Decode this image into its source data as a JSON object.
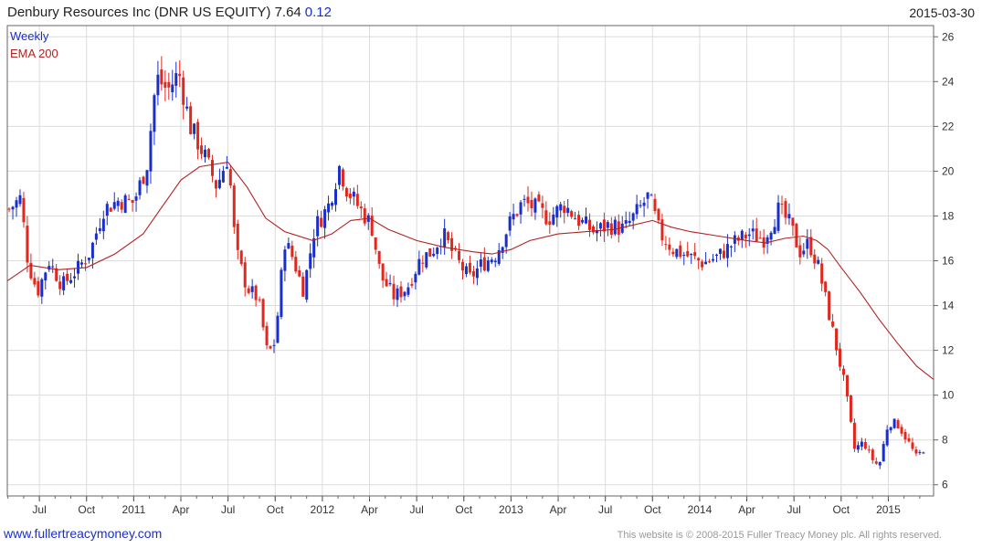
{
  "header": {
    "title": "Denbury Resources Inc (DNR US EQUITY) 7.64",
    "change": "0.12",
    "date": "2015-03-30"
  },
  "footer": {
    "site": "www.fullertreacymoney.com",
    "copyright": "This website is © 2008-2015 Fuller Treacy Money plc. All rights reserved."
  },
  "colors": {
    "up": "#1a2fc8",
    "down": "#e0281e",
    "ema": "#b22222",
    "grid": "#dcdcdc"
  },
  "chart_data": {
    "type": "candlestick",
    "legend": [
      {
        "label": "Weekly",
        "color": "#1a2fc8"
      },
      {
        "label": "EMA 200",
        "color": "#b22222"
      }
    ],
    "legend_position": "top-left",
    "grid": true,
    "y_axis_position": "right",
    "ylim": [
      5.5,
      26.5
    ],
    "yticks": [
      6,
      8,
      10,
      12,
      14,
      16,
      18,
      20,
      22,
      24,
      26
    ],
    "xlim": [
      2010.33,
      2015.24
    ],
    "xticks": [
      {
        "label": "Jul",
        "x": 2010.5
      },
      {
        "label": "Oct",
        "x": 2010.75
      },
      {
        "label": "2011",
        "x": 2011.0
      },
      {
        "label": "Apr",
        "x": 2011.25
      },
      {
        "label": "Jul",
        "x": 2011.5
      },
      {
        "label": "Oct",
        "x": 2011.75
      },
      {
        "label": "2012",
        "x": 2012.0
      },
      {
        "label": "Apr",
        "x": 2012.25
      },
      {
        "label": "Jul",
        "x": 2012.5
      },
      {
        "label": "Oct",
        "x": 2012.75
      },
      {
        "label": "2013",
        "x": 2013.0
      },
      {
        "label": "Apr",
        "x": 2013.25
      },
      {
        "label": "Jul",
        "x": 2013.5
      },
      {
        "label": "Oct",
        "x": 2013.75
      },
      {
        "label": "2014",
        "x": 2014.0
      },
      {
        "label": "Apr",
        "x": 2014.25
      },
      {
        "label": "Jul",
        "x": 2014.5
      },
      {
        "label": "Oct",
        "x": 2014.75
      },
      {
        "label": "2015",
        "x": 2015.0
      }
    ],
    "close_anchors": [
      [
        2010.34,
        18.3
      ],
      [
        2010.4,
        18.8
      ],
      [
        2010.44,
        15.9
      ],
      [
        2010.49,
        14.6
      ],
      [
        2010.55,
        16.0
      ],
      [
        2010.62,
        14.9
      ],
      [
        2010.7,
        15.6
      ],
      [
        2010.77,
        16.4
      ],
      [
        2010.84,
        18.3
      ],
      [
        2010.92,
        18.7
      ],
      [
        2011.0,
        18.6
      ],
      [
        2011.07,
        20.3
      ],
      [
        2011.12,
        24.2
      ],
      [
        2011.18,
        23.6
      ],
      [
        2011.24,
        24.4
      ],
      [
        2011.3,
        22.0
      ],
      [
        2011.38,
        20.6
      ],
      [
        2011.44,
        19.3
      ],
      [
        2011.5,
        20.7
      ],
      [
        2011.54,
        16.5
      ],
      [
        2011.6,
        14.8
      ],
      [
        2011.66,
        14.3
      ],
      [
        2011.71,
        11.8
      ],
      [
        2011.75,
        12.4
      ],
      [
        2011.8,
        16.9
      ],
      [
        2011.84,
        16.2
      ],
      [
        2011.9,
        14.7
      ],
      [
        2011.96,
        17.5
      ],
      [
        2012.03,
        18.4
      ],
      [
        2012.09,
        20.2
      ],
      [
        2012.13,
        19.2
      ],
      [
        2012.2,
        18.3
      ],
      [
        2012.26,
        17.6
      ],
      [
        2012.31,
        15.3
      ],
      [
        2012.38,
        14.4
      ],
      [
        2012.45,
        14.8
      ],
      [
        2012.52,
        16.1
      ],
      [
        2012.58,
        16.4
      ],
      [
        2012.64,
        17.2
      ],
      [
        2012.7,
        16.2
      ],
      [
        2012.78,
        15.2
      ],
      [
        2012.84,
        15.8
      ],
      [
        2012.92,
        16.3
      ],
      [
        2013.0,
        17.8
      ],
      [
        2013.06,
        18.6
      ],
      [
        2013.12,
        18.4
      ],
      [
        2013.2,
        17.9
      ],
      [
        2013.28,
        18.5
      ],
      [
        2013.36,
        17.8
      ],
      [
        2013.44,
        17.3
      ],
      [
        2013.52,
        17.6
      ],
      [
        2013.6,
        17.4
      ],
      [
        2013.68,
        18.3
      ],
      [
        2013.73,
        18.9
      ],
      [
        2013.79,
        17.2
      ],
      [
        2013.86,
        16.5
      ],
      [
        2013.94,
        16.2
      ],
      [
        2014.02,
        15.9
      ],
      [
        2014.1,
        16.2
      ],
      [
        2014.18,
        16.8
      ],
      [
        2014.26,
        17.2
      ],
      [
        2014.34,
        17.0
      ],
      [
        2014.42,
        18.3
      ],
      [
        2014.48,
        17.6
      ],
      [
        2014.53,
        16.4
      ],
      [
        2014.58,
        16.8
      ],
      [
        2014.63,
        15.7
      ],
      [
        2014.67,
        14.2
      ],
      [
        2014.72,
        12.3
      ],
      [
        2014.77,
        10.4
      ],
      [
        2014.82,
        7.6
      ],
      [
        2014.87,
        7.9
      ],
      [
        2014.91,
        7.2
      ],
      [
        2014.95,
        6.8
      ],
      [
        2015.0,
        8.8
      ],
      [
        2015.05,
        8.7
      ],
      [
        2015.1,
        8.0
      ],
      [
        2015.15,
        7.2
      ],
      [
        2015.19,
        7.64
      ]
    ],
    "ema_200": [
      [
        2010.33,
        15.1
      ],
      [
        2010.45,
        15.8
      ],
      [
        2010.6,
        15.6
      ],
      [
        2010.75,
        15.7
      ],
      [
        2010.9,
        16.3
      ],
      [
        2011.05,
        17.2
      ],
      [
        2011.15,
        18.4
      ],
      [
        2011.25,
        19.6
      ],
      [
        2011.35,
        20.2
      ],
      [
        2011.5,
        20.4
      ],
      [
        2011.6,
        19.3
      ],
      [
        2011.7,
        17.9
      ],
      [
        2011.8,
        17.3
      ],
      [
        2011.95,
        16.9
      ],
      [
        2012.05,
        17.2
      ],
      [
        2012.15,
        17.8
      ],
      [
        2012.25,
        17.9
      ],
      [
        2012.35,
        17.4
      ],
      [
        2012.5,
        16.9
      ],
      [
        2012.65,
        16.6
      ],
      [
        2012.8,
        16.4
      ],
      [
        2012.9,
        16.3
      ],
      [
        2013.0,
        16.5
      ],
      [
        2013.1,
        16.9
      ],
      [
        2013.25,
        17.2
      ],
      [
        2013.4,
        17.3
      ],
      [
        2013.55,
        17.4
      ],
      [
        2013.65,
        17.6
      ],
      [
        2013.75,
        17.8
      ],
      [
        2013.85,
        17.5
      ],
      [
        2013.95,
        17.3
      ],
      [
        2014.1,
        17.1
      ],
      [
        2014.25,
        16.9
      ],
      [
        2014.35,
        16.8
      ],
      [
        2014.45,
        17.0
      ],
      [
        2014.55,
        17.1
      ],
      [
        2014.62,
        16.9
      ],
      [
        2014.68,
        16.5
      ],
      [
        2014.75,
        15.7
      ],
      [
        2014.85,
        14.6
      ],
      [
        2014.95,
        13.4
      ],
      [
        2015.05,
        12.3
      ],
      [
        2015.15,
        11.3
      ],
      [
        2015.24,
        10.7
      ]
    ]
  }
}
